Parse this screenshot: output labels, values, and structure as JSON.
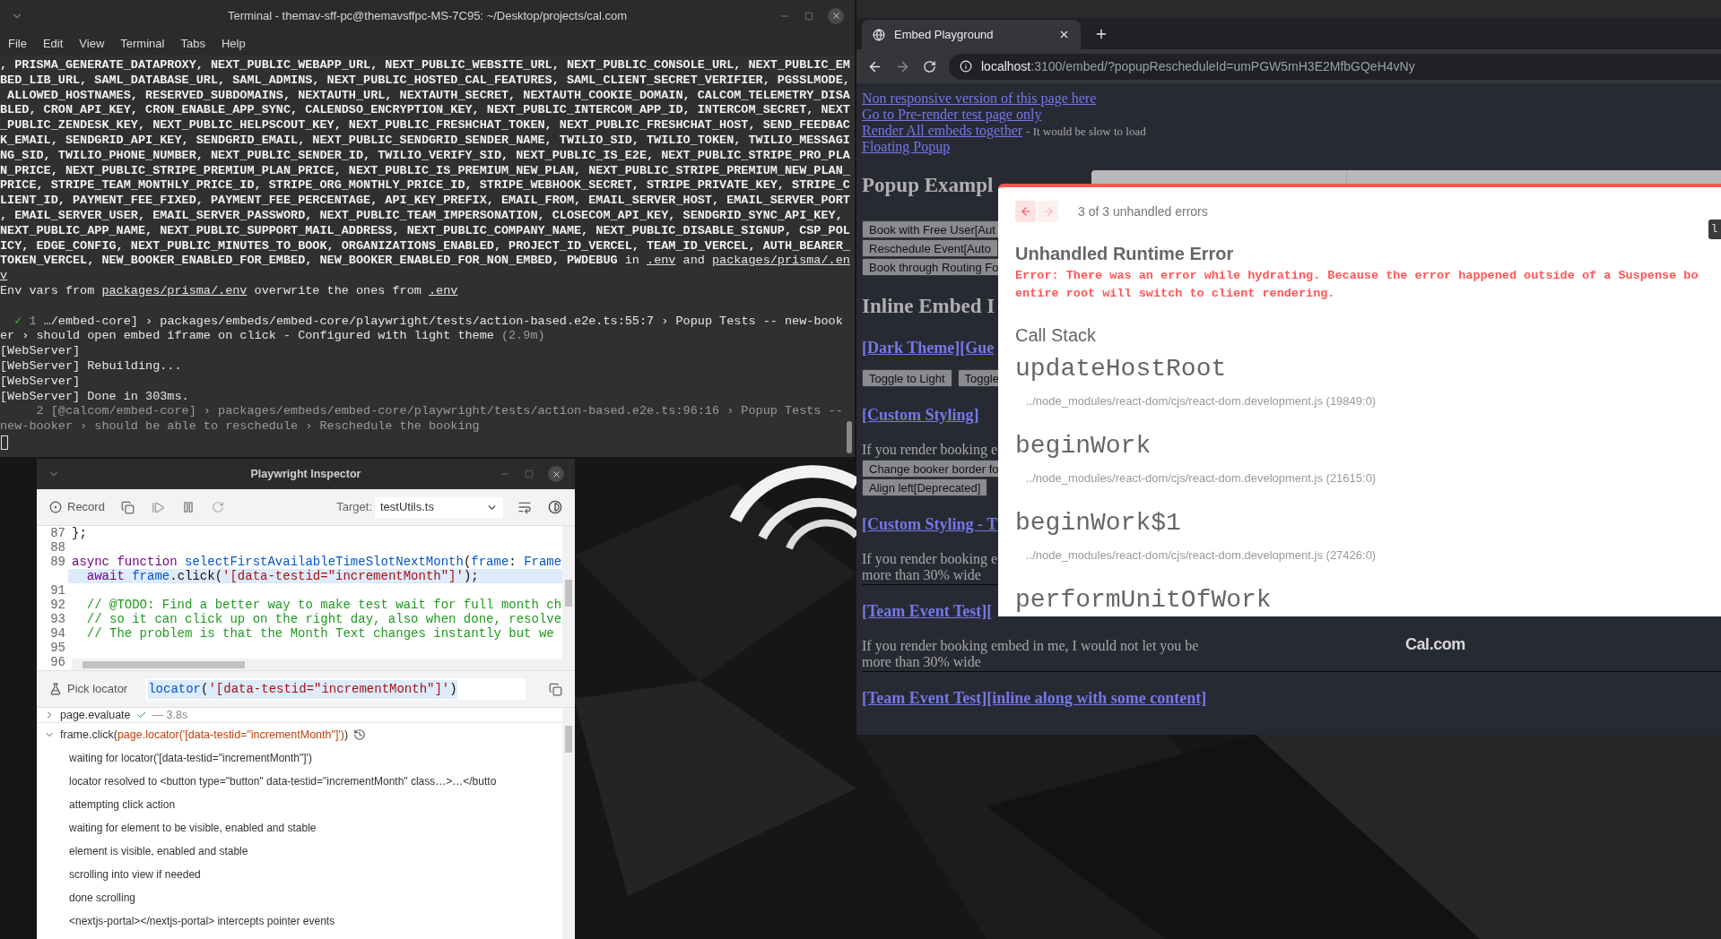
{
  "terminal": {
    "title": "Terminal - themav-sff-pc@themavsffpc-MS-7C95: ~/Desktop/projects/cal.com",
    "menu": [
      "File",
      "Edit",
      "View",
      "Terminal",
      "Tabs",
      "Help"
    ],
    "lines": [
      {
        "kind": "output",
        "segments": [
          {
            "kind": "bold",
            "text": ", PRISMA_GENERATE_DATAPROXY, NEXT_PUBLIC_WEBAPP_URL, NEXT_PUBLIC_WEBSITE_URL, NEXT_PUBLIC_CONSOLE_URL, NEXT_PUBLIC_EM"
          }
        ]
      },
      {
        "kind": "output",
        "segments": [
          {
            "kind": "bold",
            "text": "BED_LIB_URL, SAML_DATABASE_URL, SAML_ADMINS, NEXT_PUBLIC_HOSTED_CAL_FEATURES, SAML_CLIENT_SECRET_VERIFIER, PGSSLMODE,"
          }
        ]
      },
      {
        "kind": "output",
        "segments": [
          {
            "kind": "bold",
            "text": " ALLOWED_HOSTNAMES, RESERVED_SUBDOMAINS, NEXTAUTH_URL, NEXTAUTH_SECRET, NEXTAUTH_COOKIE_DOMAIN, CALCOM_TELEMETRY_DISA"
          }
        ]
      },
      {
        "kind": "output",
        "segments": [
          {
            "kind": "bold",
            "text": "BLED, CRON_API_KEY, CRON_ENABLE_APP_SYNC, CALENDSO_ENCRYPTION_KEY, NEXT_PUBLIC_INTERCOM_APP_ID, INTERCOM_SECRET, NEXT"
          }
        ]
      },
      {
        "kind": "output",
        "segments": [
          {
            "kind": "bold",
            "text": "_PUBLIC_ZENDESK_KEY, NEXT_PUBLIC_HELPSCOUT_KEY, NEXT_PUBLIC_FRESHCHAT_TOKEN, NEXT_PUBLIC_FRESHCHAT_HOST, SEND_FEEDBAC"
          }
        ]
      },
      {
        "kind": "output",
        "segments": [
          {
            "kind": "bold",
            "text": "K_EMAIL, SENDGRID_API_KEY, SENDGRID_EMAIL, NEXT_PUBLIC_SENDGRID_SENDER_NAME, TWILIO_SID, TWILIO_TOKEN, TWILIO_MESSAGI"
          }
        ]
      },
      {
        "kind": "output",
        "segments": [
          {
            "kind": "bold",
            "text": "NG_SID, TWILIO_PHONE_NUMBER, NEXT_PUBLIC_SENDER_ID, TWILIO_VERIFY_SID, NEXT_PUBLIC_IS_E2E, NEXT_PUBLIC_STRIPE_PRO_PLA"
          }
        ]
      },
      {
        "kind": "output",
        "segments": [
          {
            "kind": "bold",
            "text": "N_PRICE, NEXT_PUBLIC_STRIPE_PREMIUM_PLAN_PRICE, NEXT_PUBLIC_IS_PREMIUM_NEW_PLAN, NEXT_PUBLIC_STRIPE_PREMIUM_NEW_PLAN_"
          }
        ]
      },
      {
        "kind": "output",
        "segments": [
          {
            "kind": "bold",
            "text": "PRICE, STRIPE_TEAM_MONTHLY_PRICE_ID, STRIPE_ORG_MONTHLY_PRICE_ID, STRIPE_WEBHOOK_SECRET, STRIPE_PRIVATE_KEY, STRIPE_C"
          }
        ]
      },
      {
        "kind": "output",
        "segments": [
          {
            "kind": "bold",
            "text": "LIENT_ID, PAYMENT_FEE_FIXED, PAYMENT_FEE_PERCENTAGE, API_KEY_PREFIX, EMAIL_FROM, EMAIL_SERVER_HOST, EMAIL_SERVER_PORT"
          }
        ]
      },
      {
        "kind": "output",
        "segments": [
          {
            "kind": "bold",
            "text": ", EMAIL_SERVER_USER, EMAIL_SERVER_PASSWORD, NEXT_PUBLIC_TEAM_IMPERSONATION, CLOSECOM_API_KEY, SENDGRID_SYNC_API_KEY,"
          }
        ]
      },
      {
        "kind": "output",
        "segments": [
          {
            "kind": "bold",
            "text": "NEXT_PUBLIC_APP_NAME, NEXT_PUBLIC_SUPPORT_MAIL_ADDRESS, NEXT_PUBLIC_COMPANY_NAME, NEXT_PUBLIC_DISABLE_SIGNUP, CSP_POL"
          }
        ]
      },
      {
        "kind": "output",
        "segments": [
          {
            "kind": "bold",
            "text": "ICY, EDGE_CONFIG, NEXT_PUBLIC_MINUTES_TO_BOOK, ORGANIZATIONS_ENABLED, PROJECT_ID_VERCEL, TEAM_ID_VERCEL, AUTH_BEARER_"
          }
        ]
      },
      {
        "kind": "output",
        "segments": [
          {
            "kind": "bold",
            "text": "TOKEN_VERCEL, NEW_BOOKER_ENABLED_FOR_EMBED, NEW_BOOKER_ENABLED_FOR_NON_EMBED, PWDEBUG"
          },
          {
            "kind": "text",
            "text": " in "
          },
          {
            "kind": "link",
            "text": ".env"
          },
          {
            "kind": "text",
            "text": " and "
          },
          {
            "kind": "link",
            "text": "packages/prisma/.en"
          }
        ]
      },
      {
        "kind": "output",
        "segments": [
          {
            "kind": "link",
            "text": "v"
          }
        ]
      },
      {
        "kind": "output",
        "segments": [
          {
            "kind": "text",
            "text": "Env vars from "
          },
          {
            "kind": "link",
            "text": "packages/prisma/.env"
          },
          {
            "kind": "text",
            "text": " overwrite the ones from "
          },
          {
            "kind": "link",
            "text": ".env"
          }
        ]
      },
      {
        "kind": "blank"
      },
      {
        "kind": "output",
        "segments": [
          {
            "kind": "check",
            "text": "  ✓"
          },
          {
            "kind": "dim",
            "text": " 1 "
          },
          {
            "kind": "text",
            "text": "…/embed-core] › packages/embeds/embed-core/playwright/tests/action-based.e2e.ts:55:7 › Popup Tests -- new-book"
          }
        ]
      },
      {
        "kind": "output",
        "segments": [
          {
            "kind": "text",
            "text": "er › should open embed iframe on click - Configured with light theme "
          },
          {
            "kind": "dim",
            "text": "(2.9m)"
          }
        ]
      },
      {
        "kind": "output",
        "segments": [
          {
            "kind": "text",
            "text": "[WebServer]"
          }
        ]
      },
      {
        "kind": "output",
        "segments": [
          {
            "kind": "text",
            "text": "[WebServer] Rebuilding..."
          }
        ]
      },
      {
        "kind": "output",
        "segments": [
          {
            "kind": "text",
            "text": "[WebServer]"
          }
        ]
      },
      {
        "kind": "output",
        "segments": [
          {
            "kind": "text",
            "text": "[WebServer] Done in 303ms."
          }
        ]
      },
      {
        "kind": "output",
        "segments": [
          {
            "kind": "dim",
            "text": "     2 [@calcom/embed-core] › packages/embeds/embed-core/playwright/tests/action-based.e2e.ts:96:16 › Popup Tests --"
          }
        ]
      },
      {
        "kind": "output",
        "segments": [
          {
            "kind": "dim",
            "text": "new-booker › should be able to reschedule › Reschedule the booking"
          }
        ]
      },
      {
        "kind": "cursor"
      }
    ]
  },
  "inspector": {
    "title": "Playwright Inspector",
    "record_label": "Record",
    "target_label": "Target:",
    "target_value": "testUtils.ts",
    "code_lines": [
      {
        "number": "87",
        "selected": false,
        "tokens": [
          {
            "kind": "punct",
            "text": "};"
          }
        ]
      },
      {
        "number": "88",
        "selected": false
      },
      {
        "number": "89",
        "selected": false,
        "tokens": [
          {
            "kind": "keyword",
            "text": "async function"
          },
          {
            "kind": "name",
            "text": " selectFirstAvailableTimeSlotNextMonth"
          },
          {
            "kind": "punct",
            "text": "("
          },
          {
            "kind": "name",
            "text": "frame"
          },
          {
            "kind": "punct",
            "text": ": "
          },
          {
            "kind": "name",
            "text": "Frame"
          }
        ]
      },
      {
        "selected": true,
        "tokens": [
          {
            "kind": "keyword",
            "text": "  await"
          },
          {
            "kind": "name",
            "text": " frame"
          },
          {
            "kind": "punct",
            "text": ".click("
          },
          {
            "kind": "string",
            "text": "'[data-testid=\"incrementMonth\"]'"
          },
          {
            "kind": "punct",
            "text": ");"
          }
        ]
      },
      {
        "number": "91",
        "selected": false
      },
      {
        "number": "92",
        "selected": false,
        "tokens": [
          {
            "kind": "comment",
            "text": "  // @TODO: Find a better way to make test wait for full month ch"
          }
        ]
      },
      {
        "number": "93",
        "selected": false,
        "tokens": [
          {
            "kind": "comment",
            "text": "  // so it can click up on the right day, also when done, resolve"
          }
        ]
      },
      {
        "number": "94",
        "selected": false,
        "tokens": [
          {
            "kind": "comment",
            "text": "  // The problem is that the Month Text changes instantly but we"
          }
        ]
      },
      {
        "number": "95",
        "selected": false
      },
      {
        "number": "96",
        "selected": false
      }
    ],
    "locator_label": "Pick locator",
    "locator_tokens": [
      {
        "kind": "name",
        "text": "locator"
      },
      {
        "kind": "punct",
        "text": "("
      },
      {
        "kind": "string",
        "text": "'[data-testid=\"incrementMonth\"]'"
      },
      {
        "kind": "punct",
        "text": ")"
      }
    ],
    "log": [
      {
        "passed": true,
        "expanded": false,
        "title": [
          {
            "kind": "plain",
            "text": "page.evaluate"
          }
        ],
        "duration": "— 3.8s"
      },
      {
        "passed": false,
        "expanded": true,
        "title": [
          {
            "kind": "plain",
            "text": "frame.click("
          },
          {
            "kind": "locator",
            "text": "page.locator('[data-testid=\"incrementMonth\"]')"
          },
          {
            "kind": "plain",
            "text": ")"
          }
        ],
        "messages": [
          "waiting for locator('[data-testid=\"incrementMonth\"]')",
          "locator resolved to <button type=\"button\" data-testid=\"incrementMonth\" class…>…</butto",
          "attempting click action",
          "waiting for element to be visible, enabled and stable",
          "element is visible, enabled and stable",
          "scrolling into view if needed",
          "done scrolling",
          "<nextjs-portal></nextjs-portal> intercepts pointer events"
        ]
      }
    ]
  },
  "browser": {
    "tabs": [
      {
        "title": "Embed Playground",
        "selected": true
      }
    ],
    "url": {
      "host": "localhost",
      "path": ":3100/embed/?popupRescheduleId=umPGW5mH3E2MfbGQeH4vNy"
    },
    "page": [
      {
        "kind": "link",
        "text": "Non responsive version of this page here"
      },
      {
        "kind": "link",
        "text": "Go to Pre-render test page only"
      },
      {
        "kind": "link",
        "text": "Render All embeds together",
        "note": "- It would be slow to load"
      },
      {
        "kind": "link",
        "text": "Floating Popup"
      },
      {
        "kind": "heading",
        "text": "Popup Exampl"
      },
      {
        "kind": "buttons",
        "labels": [
          "Book with Free User[Aut"
        ]
      },
      {
        "kind": "buttons",
        "labels": [
          "Reschedule Event[Auto"
        ]
      },
      {
        "kind": "buttons",
        "labels": [
          "Book through Routing Fo"
        ]
      },
      {
        "kind": "heading",
        "text": "Inline Embed I"
      },
      {
        "kind": "section_link",
        "text": "[Dark Theme][Gue"
      },
      {
        "kind": "buttons",
        "labels": [
          "Toggle to Light",
          "Toggle"
        ]
      },
      {
        "kind": "section_link",
        "text": "[Custom Styling]"
      },
      {
        "kind": "paragraph",
        "lines": [
          "If you render booking e"
        ]
      },
      {
        "kind": "buttons",
        "labels": [
          "Change booker border fo"
        ]
      },
      {
        "kind": "buttons",
        "labels": [
          "Align left[Deprecated]"
        ]
      },
      {
        "kind": "section_link",
        "text": "[Custom Styling - T"
      },
      {
        "kind": "paragraph",
        "lines": [
          "If you render booking e",
          "more than 30% wide"
        ]
      },
      {
        "kind": "rule"
      },
      {
        "kind": "section_link",
        "text": "[Team Event Test]["
      },
      {
        "kind": "paragraph",
        "lines": [
          "If you render booking embed in me, I would not let you be",
          "more than 30% wide"
        ]
      },
      {
        "kind": "rule"
      },
      {
        "kind": "section_link",
        "text": "[Team Event Test][inline along with some content]"
      }
    ],
    "footer_logo": "Cal.com",
    "tooltip": "l",
    "error_overlay": {
      "nav": [
        {
          "disabled": false
        },
        {
          "disabled": true
        }
      ],
      "counter": "3 of 3 unhandled errors",
      "title": "Unhandled Runtime Error",
      "message_lines": [
        "Error: There was an error while hydrating. Because the error happened outside of a Suspense bo",
        "entire root will switch to client rendering."
      ],
      "call_stack_heading": "Call Stack",
      "frames": [
        {
          "name": "updateHostRoot",
          "location": "../node_modules/react-dom/cjs/react-dom.development.js (19849:0)"
        },
        {
          "name": "beginWork",
          "location": "../node_modules/react-dom/cjs/react-dom.development.js (21615:0)"
        },
        {
          "name": "beginWork$1",
          "location": "../node_modules/react-dom/cjs/react-dom.development.js (27426:0)"
        },
        {
          "name": "performUnitOfWork"
        }
      ]
    }
  }
}
